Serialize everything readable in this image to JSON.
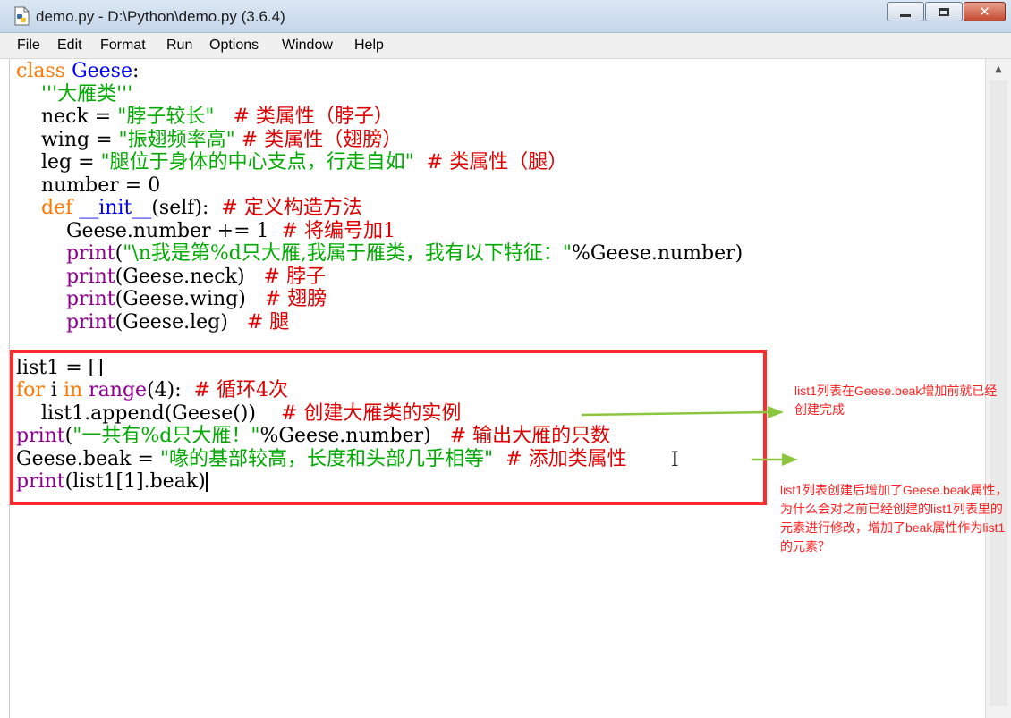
{
  "window": {
    "title": "demo.py - D:\\Python\\demo.py (3.6.4)",
    "close_glyph": "✕"
  },
  "menu": [
    "File",
    "Edit",
    "Format",
    "Run",
    "Options",
    "Window",
    "Help"
  ],
  "code": {
    "l1": [
      "class",
      " ",
      "Geese",
      ":"
    ],
    "l2": [
      "    ",
      "'''大雁类'''"
    ],
    "l3": [
      "    neck = ",
      "\"脖子较长\"",
      "   ",
      "# 类属性（脖子）"
    ],
    "l4": [
      "    wing = ",
      "\"振翅频率高\"",
      " ",
      "# 类属性（翅膀）"
    ],
    "l5": [
      "    leg = ",
      "\"腿位于身体的中心支点，行走自如\"",
      "  ",
      "# 类属性（腿）"
    ],
    "l6": [
      "    number = 0"
    ],
    "l7": [
      "    ",
      "def",
      " ",
      "__init__",
      "(self):  ",
      "# 定义构造方法"
    ],
    "l8": [
      "        Geese.number += 1  ",
      "# 将编号加1"
    ],
    "l9": [
      "        ",
      "print",
      "(",
      "\"\\n我是第%d只大雁,我属于雁类，我有以下特征：\"",
      "%Geese.number)"
    ],
    "l10": [
      "        ",
      "print",
      "(Geese.neck)   ",
      "# 脖子"
    ],
    "l11": [
      "        ",
      "print",
      "(Geese.wing)   ",
      "# 翅膀"
    ],
    "l12": [
      "        ",
      "print",
      "(Geese.leg)   ",
      "# 腿"
    ],
    "l13": [
      ""
    ],
    "l14": [
      "list1 = []"
    ],
    "l15": [
      "for",
      " i ",
      "in",
      " ",
      "range",
      "(4):  ",
      "# 循环4次"
    ],
    "l16": [
      "    list1.append(Geese())    ",
      "# 创建大雁类的实例"
    ],
    "l17": [
      "print",
      "(",
      "\"一共有%d只大雁！\"",
      "%Geese.number)   ",
      "# 输出大雁的只数"
    ],
    "l18": [
      "Geese.beak = ",
      "\"喙的基部较高，长度和头部几乎相等\"",
      "  ",
      "# 添加类属性"
    ],
    "l19": [
      "print",
      "(list1[1].beak)"
    ]
  },
  "annotations": {
    "note1": "list1列表在Geese.beak增加前就已经创建完成",
    "note2": "list1列表创建后增加了Geese.beak属性，为什么会对之前已经创建的list1列表里的元素进行修改，增加了beak属性作为list1的元素？"
  },
  "colors": {
    "keyword": "#ff7700",
    "definition": "#0000ff",
    "builtin": "#900090",
    "string": "#00aa00",
    "comment": "#dd0000",
    "highlight_box": "#ff2b2b",
    "arrow": "#8cc63f",
    "annotation_text": "#ff2020"
  },
  "icons": [
    "python-file-icon",
    "minimize-icon",
    "maximize-icon",
    "close-icon",
    "scroll-up-arrow-icon",
    "text-cursor-icon",
    "arrow-icon"
  ]
}
